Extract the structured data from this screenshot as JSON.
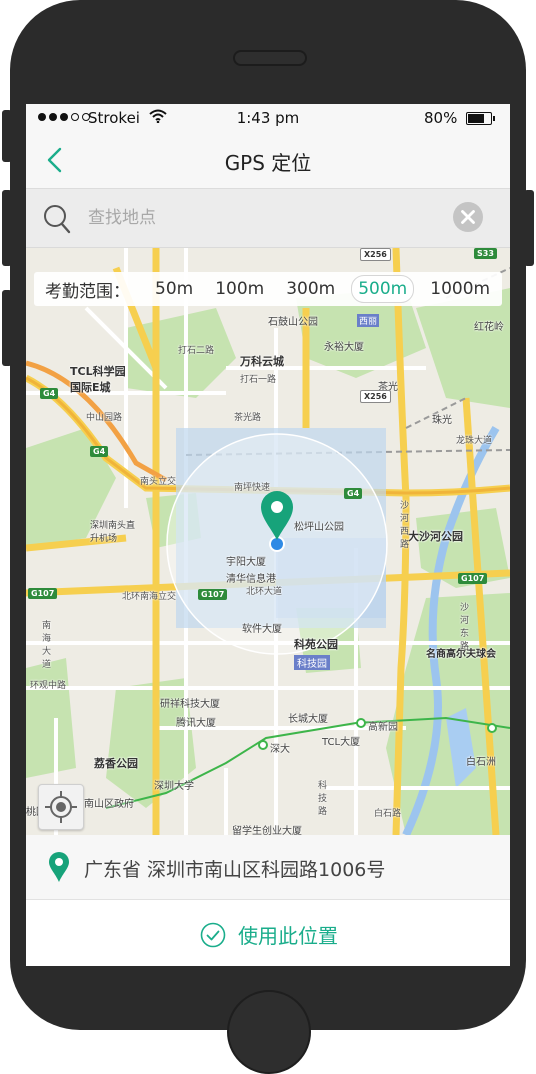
{
  "status_bar": {
    "carrier": "Strokei",
    "time": "1:43 pm",
    "battery": "80%",
    "battery_level": 0.8
  },
  "nav": {
    "title": "GPS 定位",
    "back_icon": "chevron-left-icon"
  },
  "search": {
    "placeholder": "查找地点",
    "value": ""
  },
  "range": {
    "label": "考勤范围：",
    "options": [
      "50m",
      "100m",
      "300m",
      "500m",
      "1000m"
    ],
    "selected": "500m"
  },
  "map_labels": {
    "places": [
      "万科云城",
      "TCL科学园国际E城",
      "深圳南头直升机场",
      "大沙河公园",
      "科苑公园",
      "科技园",
      "荔香公园",
      "松坪山公园",
      "宇阳大厦",
      "清华信息港",
      "软件大厦",
      "研祥科技大厦",
      "腾讯大厦",
      "长城大厦",
      "TCL大厦",
      "深圳大学",
      "南山区政府",
      "留学生创业大厦",
      "名商高尔夫球会",
      "石鼓山公园",
      "永裕大厦",
      "茶光",
      "珠光",
      "红花岭",
      "白石洲",
      "高新园",
      "深大",
      "白石路",
      "桃园"
    ],
    "roads": [
      "南坪快速",
      "北环大道",
      "北环南海立交",
      "中山园路",
      "打石一路",
      "打石二路",
      "茶光路",
      "沙河东路",
      "沙河西路",
      "南海大道",
      "科技路",
      "龙珠大道",
      "南头立交",
      "环观中路",
      "西丽"
    ],
    "shields": [
      "G4",
      "G107",
      "X256",
      "S33"
    ]
  },
  "address": "广东省 深圳市南山区科园路1006号",
  "confirm": {
    "label": "使用此位置"
  },
  "colors": {
    "accent": "#1aad8b",
    "radius_fill": "#ffffff",
    "pin": "#17a37a",
    "location_dot": "#2f8ae5"
  }
}
